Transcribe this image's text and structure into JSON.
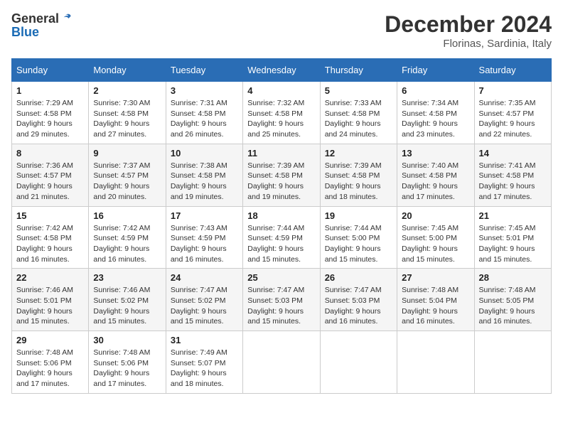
{
  "logo": {
    "text_general": "General",
    "text_blue": "Blue"
  },
  "title": {
    "month_year": "December 2024",
    "location": "Florinas, Sardinia, Italy"
  },
  "days_of_week": [
    "Sunday",
    "Monday",
    "Tuesday",
    "Wednesday",
    "Thursday",
    "Friday",
    "Saturday"
  ],
  "weeks": [
    [
      {
        "day": "1",
        "sunrise": "Sunrise: 7:29 AM",
        "sunset": "Sunset: 4:58 PM",
        "daylight": "Daylight: 9 hours and 29 minutes."
      },
      {
        "day": "2",
        "sunrise": "Sunrise: 7:30 AM",
        "sunset": "Sunset: 4:58 PM",
        "daylight": "Daylight: 9 hours and 27 minutes."
      },
      {
        "day": "3",
        "sunrise": "Sunrise: 7:31 AM",
        "sunset": "Sunset: 4:58 PM",
        "daylight": "Daylight: 9 hours and 26 minutes."
      },
      {
        "day": "4",
        "sunrise": "Sunrise: 7:32 AM",
        "sunset": "Sunset: 4:58 PM",
        "daylight": "Daylight: 9 hours and 25 minutes."
      },
      {
        "day": "5",
        "sunrise": "Sunrise: 7:33 AM",
        "sunset": "Sunset: 4:58 PM",
        "daylight": "Daylight: 9 hours and 24 minutes."
      },
      {
        "day": "6",
        "sunrise": "Sunrise: 7:34 AM",
        "sunset": "Sunset: 4:58 PM",
        "daylight": "Daylight: 9 hours and 23 minutes."
      },
      {
        "day": "7",
        "sunrise": "Sunrise: 7:35 AM",
        "sunset": "Sunset: 4:57 PM",
        "daylight": "Daylight: 9 hours and 22 minutes."
      }
    ],
    [
      {
        "day": "8",
        "sunrise": "Sunrise: 7:36 AM",
        "sunset": "Sunset: 4:57 PM",
        "daylight": "Daylight: 9 hours and 21 minutes."
      },
      {
        "day": "9",
        "sunrise": "Sunrise: 7:37 AM",
        "sunset": "Sunset: 4:57 PM",
        "daylight": "Daylight: 9 hours and 20 minutes."
      },
      {
        "day": "10",
        "sunrise": "Sunrise: 7:38 AM",
        "sunset": "Sunset: 4:58 PM",
        "daylight": "Daylight: 9 hours and 19 minutes."
      },
      {
        "day": "11",
        "sunrise": "Sunrise: 7:39 AM",
        "sunset": "Sunset: 4:58 PM",
        "daylight": "Daylight: 9 hours and 19 minutes."
      },
      {
        "day": "12",
        "sunrise": "Sunrise: 7:39 AM",
        "sunset": "Sunset: 4:58 PM",
        "daylight": "Daylight: 9 hours and 18 minutes."
      },
      {
        "day": "13",
        "sunrise": "Sunrise: 7:40 AM",
        "sunset": "Sunset: 4:58 PM",
        "daylight": "Daylight: 9 hours and 17 minutes."
      },
      {
        "day": "14",
        "sunrise": "Sunrise: 7:41 AM",
        "sunset": "Sunset: 4:58 PM",
        "daylight": "Daylight: 9 hours and 17 minutes."
      }
    ],
    [
      {
        "day": "15",
        "sunrise": "Sunrise: 7:42 AM",
        "sunset": "Sunset: 4:58 PM",
        "daylight": "Daylight: 9 hours and 16 minutes."
      },
      {
        "day": "16",
        "sunrise": "Sunrise: 7:42 AM",
        "sunset": "Sunset: 4:59 PM",
        "daylight": "Daylight: 9 hours and 16 minutes."
      },
      {
        "day": "17",
        "sunrise": "Sunrise: 7:43 AM",
        "sunset": "Sunset: 4:59 PM",
        "daylight": "Daylight: 9 hours and 16 minutes."
      },
      {
        "day": "18",
        "sunrise": "Sunrise: 7:44 AM",
        "sunset": "Sunset: 4:59 PM",
        "daylight": "Daylight: 9 hours and 15 minutes."
      },
      {
        "day": "19",
        "sunrise": "Sunrise: 7:44 AM",
        "sunset": "Sunset: 5:00 PM",
        "daylight": "Daylight: 9 hours and 15 minutes."
      },
      {
        "day": "20",
        "sunrise": "Sunrise: 7:45 AM",
        "sunset": "Sunset: 5:00 PM",
        "daylight": "Daylight: 9 hours and 15 minutes."
      },
      {
        "day": "21",
        "sunrise": "Sunrise: 7:45 AM",
        "sunset": "Sunset: 5:01 PM",
        "daylight": "Daylight: 9 hours and 15 minutes."
      }
    ],
    [
      {
        "day": "22",
        "sunrise": "Sunrise: 7:46 AM",
        "sunset": "Sunset: 5:01 PM",
        "daylight": "Daylight: 9 hours and 15 minutes."
      },
      {
        "day": "23",
        "sunrise": "Sunrise: 7:46 AM",
        "sunset": "Sunset: 5:02 PM",
        "daylight": "Daylight: 9 hours and 15 minutes."
      },
      {
        "day": "24",
        "sunrise": "Sunrise: 7:47 AM",
        "sunset": "Sunset: 5:02 PM",
        "daylight": "Daylight: 9 hours and 15 minutes."
      },
      {
        "day": "25",
        "sunrise": "Sunrise: 7:47 AM",
        "sunset": "Sunset: 5:03 PM",
        "daylight": "Daylight: 9 hours and 15 minutes."
      },
      {
        "day": "26",
        "sunrise": "Sunrise: 7:47 AM",
        "sunset": "Sunset: 5:03 PM",
        "daylight": "Daylight: 9 hours and 16 minutes."
      },
      {
        "day": "27",
        "sunrise": "Sunrise: 7:48 AM",
        "sunset": "Sunset: 5:04 PM",
        "daylight": "Daylight: 9 hours and 16 minutes."
      },
      {
        "day": "28",
        "sunrise": "Sunrise: 7:48 AM",
        "sunset": "Sunset: 5:05 PM",
        "daylight": "Daylight: 9 hours and 16 minutes."
      }
    ],
    [
      {
        "day": "29",
        "sunrise": "Sunrise: 7:48 AM",
        "sunset": "Sunset: 5:06 PM",
        "daylight": "Daylight: 9 hours and 17 minutes."
      },
      {
        "day": "30",
        "sunrise": "Sunrise: 7:48 AM",
        "sunset": "Sunset: 5:06 PM",
        "daylight": "Daylight: 9 hours and 17 minutes."
      },
      {
        "day": "31",
        "sunrise": "Sunrise: 7:49 AM",
        "sunset": "Sunset: 5:07 PM",
        "daylight": "Daylight: 9 hours and 18 minutes."
      },
      null,
      null,
      null,
      null
    ]
  ]
}
